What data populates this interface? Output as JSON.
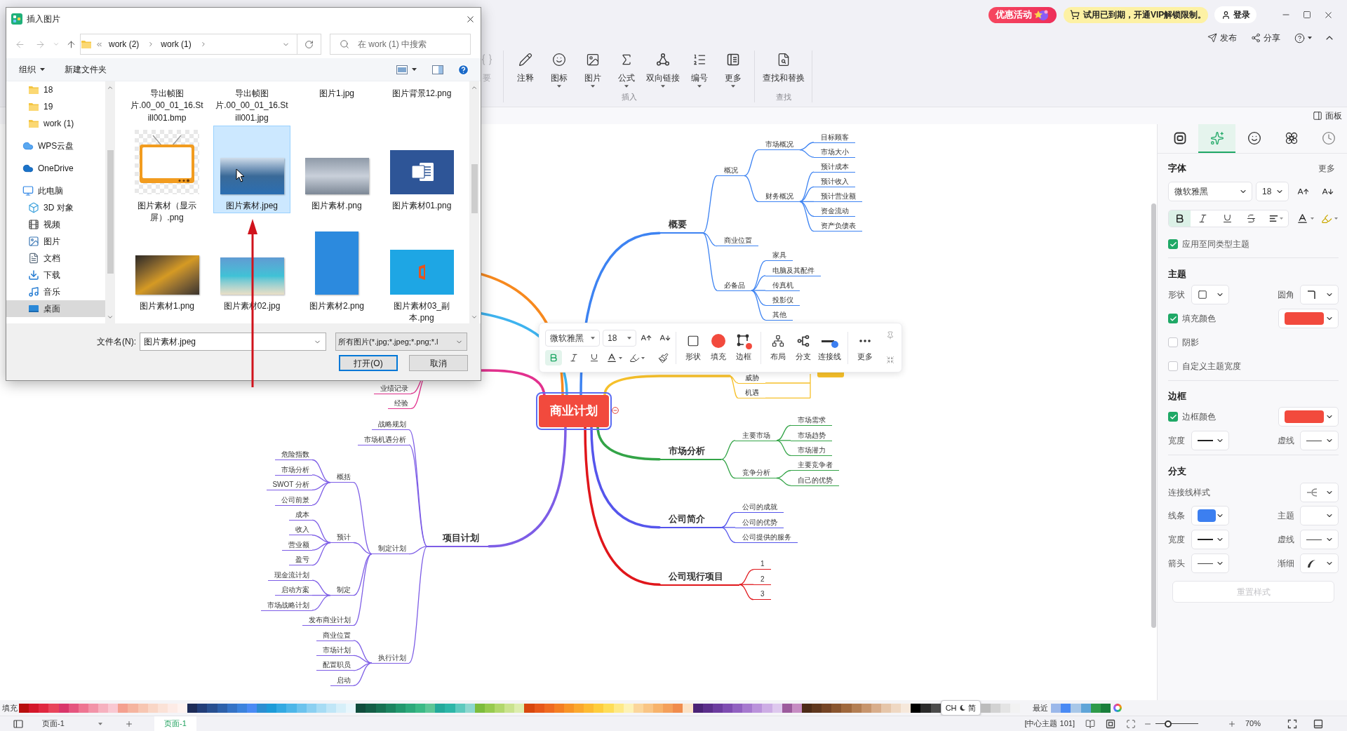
{
  "file_dialog": {
    "title": "插入图片",
    "path": [
      "work (2)",
      "work (1)"
    ],
    "search_placeholder": "在 work (1) 中搜索",
    "commands": [
      {
        "label": "组织",
        "dropdown": true
      },
      {
        "label": "新建文件夹",
        "dropdown": false
      }
    ],
    "nav": [
      {
        "children": [
          {
            "label": "18",
            "kind": "folder",
            "selected": false
          },
          {
            "label": "19",
            "kind": "folder",
            "selected": false
          },
          {
            "label": "work (1)",
            "kind": "folder",
            "selected": false
          }
        ]
      },
      {
        "label": "WPS云盘",
        "kind": "cloud",
        "selected": false
      },
      {
        "label": "OneDrive",
        "kind": "onedrive",
        "selected": false
      },
      {
        "label": "此电脑",
        "kind": "computer",
        "selected": false,
        "children": [
          {
            "label": "3D 对象",
            "kind": "objects",
            "selected": false
          },
          {
            "label": "视频",
            "kind": "video",
            "selected": false
          },
          {
            "label": "图片",
            "kind": "pictures",
            "selected": false
          },
          {
            "label": "文档",
            "kind": "documents",
            "selected": false
          },
          {
            "label": "下载",
            "kind": "downloads",
            "selected": false
          },
          {
            "label": "音乐",
            "kind": "music",
            "selected": false
          },
          {
            "label": "桌面",
            "kind": "desktop",
            "selected": true
          }
        ]
      }
    ],
    "files": [
      {
        "name": "导出帧图片.00_00_01_16.Still001.bmp",
        "selected": false
      },
      {
        "name": "导出帧图片.00_00_01_16.Still001.jpg",
        "selected": false
      },
      {
        "name": "图片1.jpg",
        "selected": false
      },
      {
        "name": "图片背景12.png",
        "selected": false
      },
      {
        "name": "图片素材（显示屏）.png",
        "kind": "tv",
        "selected": false
      },
      {
        "name": "图片素材.jpeg",
        "kind": "landscape",
        "selected": true
      },
      {
        "name": "图片素材.png",
        "kind": "masked_person",
        "selected": false
      },
      {
        "name": "图片素材01.png",
        "kind": "document",
        "selected": false
      },
      {
        "name": "图片素材1.png",
        "kind": "leaf",
        "selected": false
      },
      {
        "name": "图片素材02.jpg",
        "kind": "beach",
        "selected": false
      },
      {
        "name": "图片素材2.png",
        "kind": "portrait",
        "selected": false
      },
      {
        "name": "图片素材03_副本.png",
        "kind": "logo_tile",
        "selected": false
      }
    ],
    "file_name_label": "文件名(N):",
    "file_name": "图片素材.jpeg",
    "file_type": "所有图片(*.jpg;*.jpeg;*.png;*.l",
    "buttons": [
      {
        "label": "打开(O)",
        "kind": "default"
      },
      {
        "label": "取消",
        "kind": "normal"
      }
    ]
  },
  "title_bar": {
    "promo": "优惠活动",
    "trial_notice": "试用已到期，开通VIP解锁限制。",
    "login": "登录"
  },
  "header_actions": [
    {
      "kind": "publish",
      "label": "发布"
    },
    {
      "kind": "share",
      "label": "分享"
    },
    {
      "kind": "help"
    },
    {
      "kind": "collapse"
    }
  ],
  "ribbon": {
    "groups": [
      {
        "items": [
          {
            "kind": "summary",
            "label": "要",
            "disabled": true,
            "dropdown": false
          }
        ]
      },
      {
        "label": "插入",
        "items": [
          {
            "kind": "note",
            "label": "注释",
            "disabled": false,
            "dropdown": false
          },
          {
            "kind": "icon",
            "label": "图标",
            "disabled": false,
            "dropdown": true
          },
          {
            "kind": "image",
            "label": "图片",
            "disabled": false,
            "dropdown": true
          },
          {
            "kind": "formula",
            "label": "公式",
            "disabled": false,
            "dropdown": true
          },
          {
            "kind": "link",
            "label": "双向链接",
            "disabled": false,
            "dropdown": true
          },
          {
            "kind": "numbering",
            "label": "编号",
            "disabled": false,
            "dropdown": true
          },
          {
            "kind": "more",
            "label": "更多",
            "disabled": false,
            "dropdown": true
          }
        ]
      },
      {
        "label": "查找",
        "items": [
          {
            "kind": "find",
            "label": "查找和替换",
            "disabled": false,
            "dropdown": false
          }
        ]
      }
    ]
  },
  "panel_toggle": {
    "label": "面板"
  },
  "mind_map": {
    "central_topic": {
      "text": "商业计划",
      "selected": true,
      "expanded": true
    },
    "right_branches": [
      {
        "text": "概要",
        "color": "#3d83f2",
        "children": [
          {
            "text": "概况",
            "children": [
              {
                "text": "市场概况",
                "children": [
                  {
                    "text": "目标顾客"
                  },
                  {
                    "text": "市场大小"
                  }
                ]
              },
              {
                "text": "财务概况",
                "children": [
                  {
                    "text": "预计成本"
                  },
                  {
                    "text": "预计收入"
                  },
                  {
                    "text": "预计营业额"
                  },
                  {
                    "text": "资金流动"
                  },
                  {
                    "text": "资产负债表"
                  }
                ]
              }
            ]
          },
          {
            "text": "商业位置"
          },
          {
            "text": "必备品",
            "children": [
              {
                "text": "家具"
              },
              {
                "text": "电脑及其配件"
              },
              {
                "text": "传真机"
              },
              {
                "text": "投影仪"
              },
              {
                "text": "其他"
              }
            ]
          }
        ]
      },
      {
        "color": "#f6c02a",
        "summary": true,
        "children": [
          {
            "text": "威胁"
          },
          {
            "text": "机遇"
          }
        ]
      },
      {
        "text": "市场分析",
        "color": "#33a447",
        "children": [
          {
            "text": "主要市场",
            "children": [
              {
                "text": "市场需求"
              },
              {
                "text": "市场趋势"
              },
              {
                "text": "市场潜力"
              }
            ]
          },
          {
            "text": "竞争分析",
            "children": [
              {
                "text": "主要竞争者"
              },
              {
                "text": "自己的优势"
              }
            ]
          }
        ]
      },
      {
        "text": "公司简介",
        "color": "#5555ec",
        "children": [
          {
            "text": "公司的成就"
          },
          {
            "text": "公司的优势"
          },
          {
            "text": "公司提供的服务"
          }
        ]
      },
      {
        "text": "公司现行项目",
        "color": "#e0161b",
        "children": [
          {
            "text": "1"
          },
          {
            "text": "2"
          },
          {
            "text": "3"
          }
        ]
      }
    ],
    "left_branches": [
      {
        "text": "项目计划",
        "color": "#7d5de6",
        "children": [
          {
            "text": "战略规划"
          },
          {
            "text": "市场机遇分析"
          },
          {
            "text": "制定计划",
            "children": [
              {
                "text": "概括",
                "children": [
                  {
                    "text": "危险指数"
                  },
                  {
                    "text": "市场分析"
                  },
                  {
                    "text": "SWOT 分析"
                  },
                  {
                    "text": "公司前景"
                  }
                ]
              },
              {
                "text": "预计",
                "children": [
                  {
                    "text": "成本"
                  },
                  {
                    "text": "收入"
                  },
                  {
                    "text": "营业额"
                  },
                  {
                    "text": "盈亏"
                  }
                ]
              },
              {
                "text": "制定",
                "children": [
                  {
                    "text": "现金流计划"
                  },
                  {
                    "text": "启动方案"
                  },
                  {
                    "text": "市场战略计划"
                  }
                ]
              },
              {
                "text": "发布商业计划"
              }
            ]
          },
          {
            "text": "执行计划",
            "children": [
              {
                "text": "商业位置"
              },
              {
                "text": "市场计划"
              },
              {
                "text": "配置职员"
              },
              {
                "text": "启动"
              }
            ]
          }
        ]
      },
      {
        "color": "#e2318e",
        "children": [
          {
            "text": "业绩记录"
          },
          {
            "text": "经验"
          }
        ]
      },
      {
        "color": "#3eb3ef"
      },
      {
        "color": "#f7891e"
      }
    ]
  },
  "floating_toolbar": {
    "font": "微软雅黑",
    "size": "18",
    "styles": [
      {
        "kind": "bold",
        "selected": true
      },
      {
        "kind": "italic",
        "selected": false
      },
      {
        "kind": "underline",
        "selected": false
      }
    ],
    "tool_groups": [
      [
        {
          "kind": "shape",
          "label": "形状"
        },
        {
          "kind": "fill",
          "label": "填充",
          "color": "#f24a3d"
        },
        {
          "kind": "border",
          "label": "边框",
          "color": "#f24a3d"
        }
      ],
      [
        {
          "kind": "layout",
          "label": "布局"
        },
        {
          "kind": "branch",
          "label": "分支"
        },
        {
          "kind": "connector",
          "label": "连接线",
          "color": "#3c7ff0"
        }
      ],
      [
        {
          "kind": "more",
          "label": "更多"
        }
      ]
    ]
  },
  "side_panel": {
    "tabs": [
      {
        "kind": "frame",
        "selected": false
      },
      {
        "kind": "sparkle",
        "selected": true
      },
      {
        "kind": "emoji",
        "selected": false
      },
      {
        "kind": "badge",
        "selected": false
      },
      {
        "kind": "history",
        "selected": false
      }
    ],
    "font": {
      "title": "字体",
      "more": "更多",
      "family": "微软雅黑",
      "size": "18",
      "styles": [
        {
          "kind": "bold",
          "selected": true
        },
        {
          "kind": "italic",
          "selected": false
        },
        {
          "kind": "underline",
          "selected": false
        },
        {
          "kind": "strikethrough",
          "selected": false
        },
        {
          "kind": "align",
          "selected": false
        }
      ],
      "apply_same": {
        "label": "应用至同类型主题",
        "checked": true
      }
    },
    "topic": {
      "title": "主题",
      "shape_label": "形状",
      "corner_label": "圆角",
      "fill": {
        "label": "填充颜色",
        "checked": true,
        "color": "#f24a3d"
      },
      "options": [
        {
          "label": "阴影",
          "checked": false
        },
        {
          "label": "自定义主题宽度",
          "checked": false
        }
      ]
    },
    "border": {
      "title": "边框",
      "color_option": {
        "label": "边框颜色",
        "checked": true,
        "color": "#f24a3d"
      },
      "width_label": "宽度",
      "dash_label": "虚线"
    },
    "branch": {
      "title": "分支",
      "style_label": "连接线样式",
      "line": {
        "label": "线条",
        "color": "#3c7ff0"
      },
      "topic_label": "主题",
      "width_label": "宽度",
      "dash_label": "虚线",
      "arrow_label": "箭头",
      "taper_label": "渐细"
    },
    "reset": {
      "label": "重置样式",
      "disabled": true
    }
  },
  "palette": {
    "label": "填充",
    "groups": [
      [
        {
          "color": "#b80f0f"
        },
        {
          "color": "#d4172a"
        },
        {
          "color": "#e02840"
        },
        {
          "color": "#e8445a"
        },
        {
          "color": "#d9366b"
        },
        {
          "color": "#e5557f"
        },
        {
          "color": "#ee7592"
        },
        {
          "color": "#f293a8"
        },
        {
          "color": "#f6b1bf"
        },
        {
          "color": "#f9c8d2"
        },
        {
          "color": "#f4a08f"
        },
        {
          "color": "#f5b49f"
        },
        {
          "color": "#f7c6b2"
        },
        {
          "color": "#f9d6c6"
        },
        {
          "color": "#fbe2d7"
        },
        {
          "color": "#fdebe6"
        },
        {
          "color": "#fef3f0"
        },
        {
          "color": "#1d2b57"
        },
        {
          "color": "#223d78"
        },
        {
          "color": "#284f90"
        },
        {
          "color": "#2d60aa"
        },
        {
          "color": "#3472c6"
        },
        {
          "color": "#3b82dd"
        },
        {
          "color": "#4a8af4"
        },
        {
          "color": "#2b8ed2"
        },
        {
          "color": "#1d9bd8"
        },
        {
          "color": "#33a9e2"
        },
        {
          "color": "#4db6e8"
        },
        {
          "color": "#6cc3ed"
        },
        {
          "color": "#8bd0f1"
        },
        {
          "color": "#a7dcf4"
        },
        {
          "color": "#c0e6f7"
        },
        {
          "color": "#d6eff9"
        },
        {
          "color": "#e8f6fc"
        },
        {
          "color": "#114d3d"
        },
        {
          "color": "#145e47"
        },
        {
          "color": "#177152"
        },
        {
          "color": "#1c8460"
        },
        {
          "color": "#23986e"
        },
        {
          "color": "#2da97b"
        },
        {
          "color": "#3bb986"
        },
        {
          "color": "#5cc697"
        },
        {
          "color": "#23a99b"
        },
        {
          "color": "#2db6a8"
        },
        {
          "color": "#5dc9be"
        },
        {
          "color": "#8dd7cf"
        },
        {
          "color": "#7dbc3c"
        },
        {
          "color": "#97ca4f"
        },
        {
          "color": "#b1d76c"
        },
        {
          "color": "#cae38e"
        },
        {
          "color": "#ddedae"
        },
        {
          "color": "#d8470e"
        },
        {
          "color": "#e7581a"
        },
        {
          "color": "#ef6a21"
        },
        {
          "color": "#f47e23"
        },
        {
          "color": "#f89427"
        },
        {
          "color": "#fba82e"
        },
        {
          "color": "#fdbb33"
        },
        {
          "color": "#fecd3d"
        },
        {
          "color": "#fedd58"
        },
        {
          "color": "#fee987"
        },
        {
          "color": "#fdf2b6"
        },
        {
          "color": "#fbd69b"
        },
        {
          "color": "#f9c585"
        },
        {
          "color": "#f7b36c"
        },
        {
          "color": "#f4a05b"
        },
        {
          "color": "#f08c4d"
        },
        {
          "color": "#fbe2c6"
        },
        {
          "color": "#4a2276"
        },
        {
          "color": "#5b2e8b"
        },
        {
          "color": "#6c3c9f"
        },
        {
          "color": "#7e4cb1"
        },
        {
          "color": "#9161c1"
        },
        {
          "color": "#a679cf"
        },
        {
          "color": "#ba92db"
        },
        {
          "color": "#cdade5"
        },
        {
          "color": "#dec8ee"
        },
        {
          "color": "#9c5b9d"
        },
        {
          "color": "#c68cc3"
        },
        {
          "color": "#4d2b17"
        },
        {
          "color": "#5f371e"
        },
        {
          "color": "#744425"
        },
        {
          "color": "#89552f"
        },
        {
          "color": "#9f683d"
        },
        {
          "color": "#b37e53"
        },
        {
          "color": "#c7956d"
        },
        {
          "color": "#d8ad8b"
        },
        {
          "color": "#e6c6aa"
        },
        {
          "color": "#efd8c3"
        },
        {
          "color": "#f6e8db"
        },
        {
          "color": "#000000"
        },
        {
          "color": "#2a2a2a"
        },
        {
          "color": "#4b4b4b"
        }
      ],
      [
        {
          "color": "#bcbcbc"
        },
        {
          "color": "#d2d2d2"
        },
        {
          "color": "#e4e4e4"
        },
        {
          "color": "#f2f2f2"
        }
      ]
    ],
    "recent_label": "最近",
    "recent": [
      {
        "color": "#9bb8ea"
      },
      {
        "color": "#4a8af4"
      },
      {
        "color": "#a8c7e8"
      },
      {
        "color": "#60a5d8"
      },
      {
        "color": "#2e9a4a"
      },
      {
        "color": "#1a7f3c"
      }
    ]
  },
  "ime_indicator": {
    "mode": "CH",
    "script": "简"
  },
  "status_bar": {
    "page_select": "页面-1",
    "pages": [
      {
        "label": "页面-1",
        "selected": true
      }
    ],
    "topic_count": "[中心主题 101]",
    "zoom": {
      "level": 0.3,
      "reading": "70%"
    }
  }
}
